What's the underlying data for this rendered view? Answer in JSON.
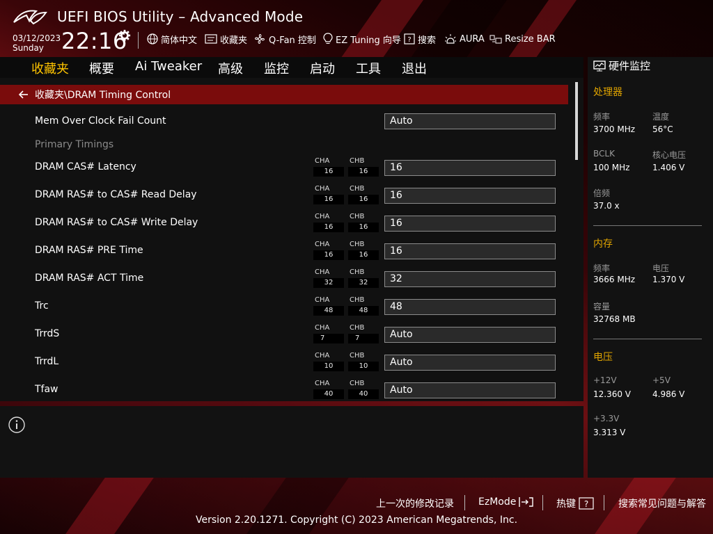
{
  "app": {
    "title": "UEFI BIOS Utility – Advanced Mode",
    "date": "03/12/2023",
    "day": "Sunday",
    "time": "22:16"
  },
  "toolbar": {
    "items": [
      {
        "label": "简体中文",
        "icon": "globe-icon"
      },
      {
        "label": "收藏夹",
        "icon": "favorites-icon"
      },
      {
        "label": "Q-Fan 控制",
        "icon": "fan-icon"
      },
      {
        "label": "EZ Tuning 向导",
        "icon": "lightbulb-icon"
      },
      {
        "label": "搜索",
        "icon": "help-search-icon"
      },
      {
        "label": "AURA",
        "icon": "aura-icon"
      },
      {
        "label": "Resize BAR",
        "icon": "resize-bar-icon"
      }
    ]
  },
  "menu": {
    "items": [
      "收藏夹",
      "概要",
      "Ai Tweaker",
      "高级",
      "监控",
      "启动",
      "工具",
      "退出"
    ],
    "active": "收藏夹"
  },
  "breadcrumb": "收藏夹\\DRAM Timing Control",
  "settings": {
    "mem_fail_label": "Mem Over Clock Fail Count",
    "mem_fail_value": "Auto",
    "section_label": "Primary Timings",
    "ch_a": "CHA",
    "ch_b": "CHB",
    "rows": [
      {
        "label": "DRAM CAS# Latency",
        "cha": "16",
        "chb": "16",
        "value": "16"
      },
      {
        "label": "DRAM RAS# to CAS# Read Delay",
        "cha": "16",
        "chb": "16",
        "value": "16"
      },
      {
        "label": "DRAM RAS# to CAS# Write Delay",
        "cha": "16",
        "chb": "16",
        "value": "16"
      },
      {
        "label": "DRAM RAS# PRE Time",
        "cha": "16",
        "chb": "16",
        "value": "16"
      },
      {
        "label": "DRAM RAS# ACT Time",
        "cha": "32",
        "chb": "32",
        "value": "32"
      },
      {
        "label": "Trc",
        "cha": "48",
        "chb": "48",
        "value": "48"
      },
      {
        "label": "TrrdS",
        "cha": "7",
        "chb": "7",
        "value": "Auto"
      },
      {
        "label": "TrrdL",
        "cha": "10",
        "chb": "10",
        "value": "Auto"
      },
      {
        "label": "Tfaw",
        "cha": "40",
        "chb": "40",
        "value": "Auto"
      }
    ]
  },
  "hw": {
    "title": "硬件监控",
    "cpu": {
      "title": "处理器",
      "freq_label": "频率",
      "freq": "3700 MHz",
      "temp_label": "温度",
      "temp": "56°C",
      "bclk_label": "BCLK",
      "bclk": "100 MHz",
      "vcore_label": "核心电压",
      "vcore": "1.406 V",
      "ratio_label": "倍频",
      "ratio": "37.0 x"
    },
    "mem": {
      "title": "内存",
      "freq_label": "频率",
      "freq": "3666 MHz",
      "volt_label": "电压",
      "volt": "1.370 V",
      "cap_label": "容量",
      "cap": "32768 MB"
    },
    "volt": {
      "title": "电压",
      "v12_label": "+12V",
      "v12": "12.360 V",
      "v5_label": "+5V",
      "v5": "4.986 V",
      "v33_label": "+3.3V",
      "v33": "3.313 V"
    }
  },
  "footer": {
    "last_modified": "上一次的修改记录",
    "ezmode": "EzMode",
    "hotkeys": "热键",
    "faq": "搜索常见问题与解答",
    "copyright": "Version 2.20.1271. Copyright (C) 2023 American Megatrends, Inc."
  },
  "colors": {
    "accent": "#ffc400",
    "section": "#e0a400",
    "breadcrumb_bg": "#7a0c0c"
  }
}
